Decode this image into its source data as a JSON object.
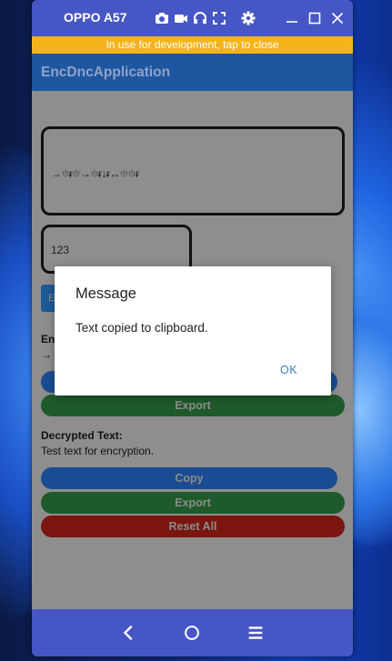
{
  "window": {
    "title": "OPPO A57",
    "icons": [
      "camera-icon",
      "video-icon",
      "headphones-icon",
      "fullscreen-icon",
      "gear-icon",
      "minimize-icon",
      "maximize-icon",
      "close-icon"
    ]
  },
  "dev_banner": "In use for development, tap to close",
  "app_bar": {
    "title": "EncDncApplication"
  },
  "inputs": {
    "plain_text_value": "→⯐ᵲ⯐→⯐ᵲ↓ᵲ↔⯐⯐ᵲ",
    "key_value": "123"
  },
  "encrypted_section": {
    "label": "En",
    "value": "→"
  },
  "buttons": {
    "encrypt_partial": "E",
    "export_encrypted": "Export",
    "copy_decrypted": "Copy",
    "export_decrypted": "Export",
    "reset_all": "Reset All"
  },
  "decrypted_section": {
    "label": "Decrypted Text:",
    "value": "Test text for encryption."
  },
  "dialog": {
    "title": "Message",
    "message": "Text copied to clipboard.",
    "ok_label": "OK"
  },
  "nav": {
    "icons": [
      "back-icon",
      "home-icon",
      "menu-icon"
    ]
  },
  "colors": {
    "device_frame": "#4656c4",
    "dev_banner": "#f3b41c",
    "app_bar": "#1e56a0",
    "blue_button": "#1a4c93",
    "green_button": "#1e5a2a",
    "red_button": "#7a1510",
    "dialog_accent": "#3d7cc0"
  }
}
